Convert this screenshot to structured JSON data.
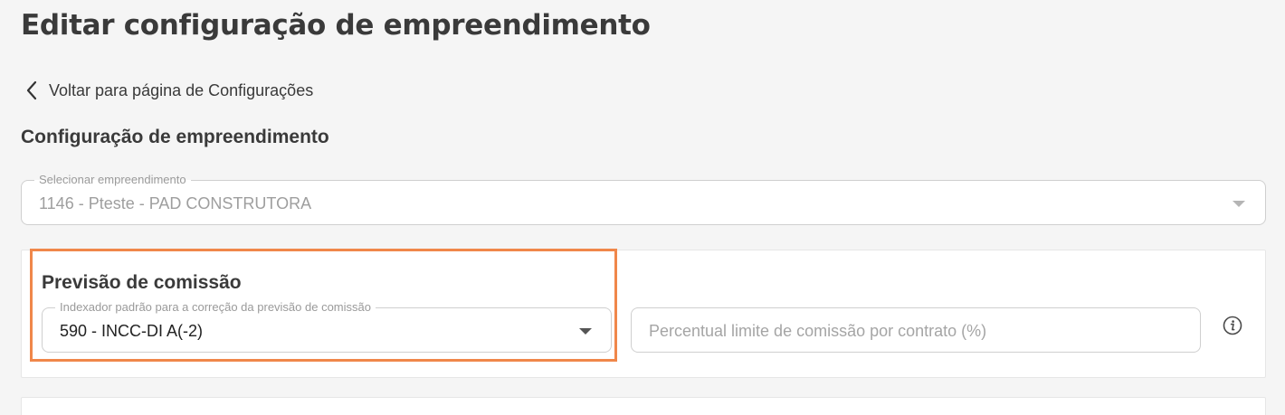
{
  "header": {
    "title": "Editar configuração de empreendimento"
  },
  "back": {
    "label": "Voltar para página de Configurações",
    "icon": "chevron-left-icon"
  },
  "section": {
    "title": "Configuração de empreendimento"
  },
  "enterprise_select": {
    "label": "Selecionar empreendimento",
    "value": "1146 - Pteste - PAD CONSTRUTORA",
    "icon": "arrow-down-icon"
  },
  "commission": {
    "title": "Previsão de comissão",
    "indexer": {
      "label": "Indexador padrão para a correção da previsão de comissão",
      "value": "590 - INCC-DI A(-2)",
      "icon": "arrow-down-icon"
    },
    "percent_limit": {
      "placeholder": "Percentual limite de comissão por contrato (%)",
      "value": ""
    },
    "info_icon": "info-icon"
  },
  "colors": {
    "background": "#f5f5f5",
    "highlight": "#f0874a",
    "text": "#3a3a3a",
    "muted": "#9e9e9e"
  }
}
